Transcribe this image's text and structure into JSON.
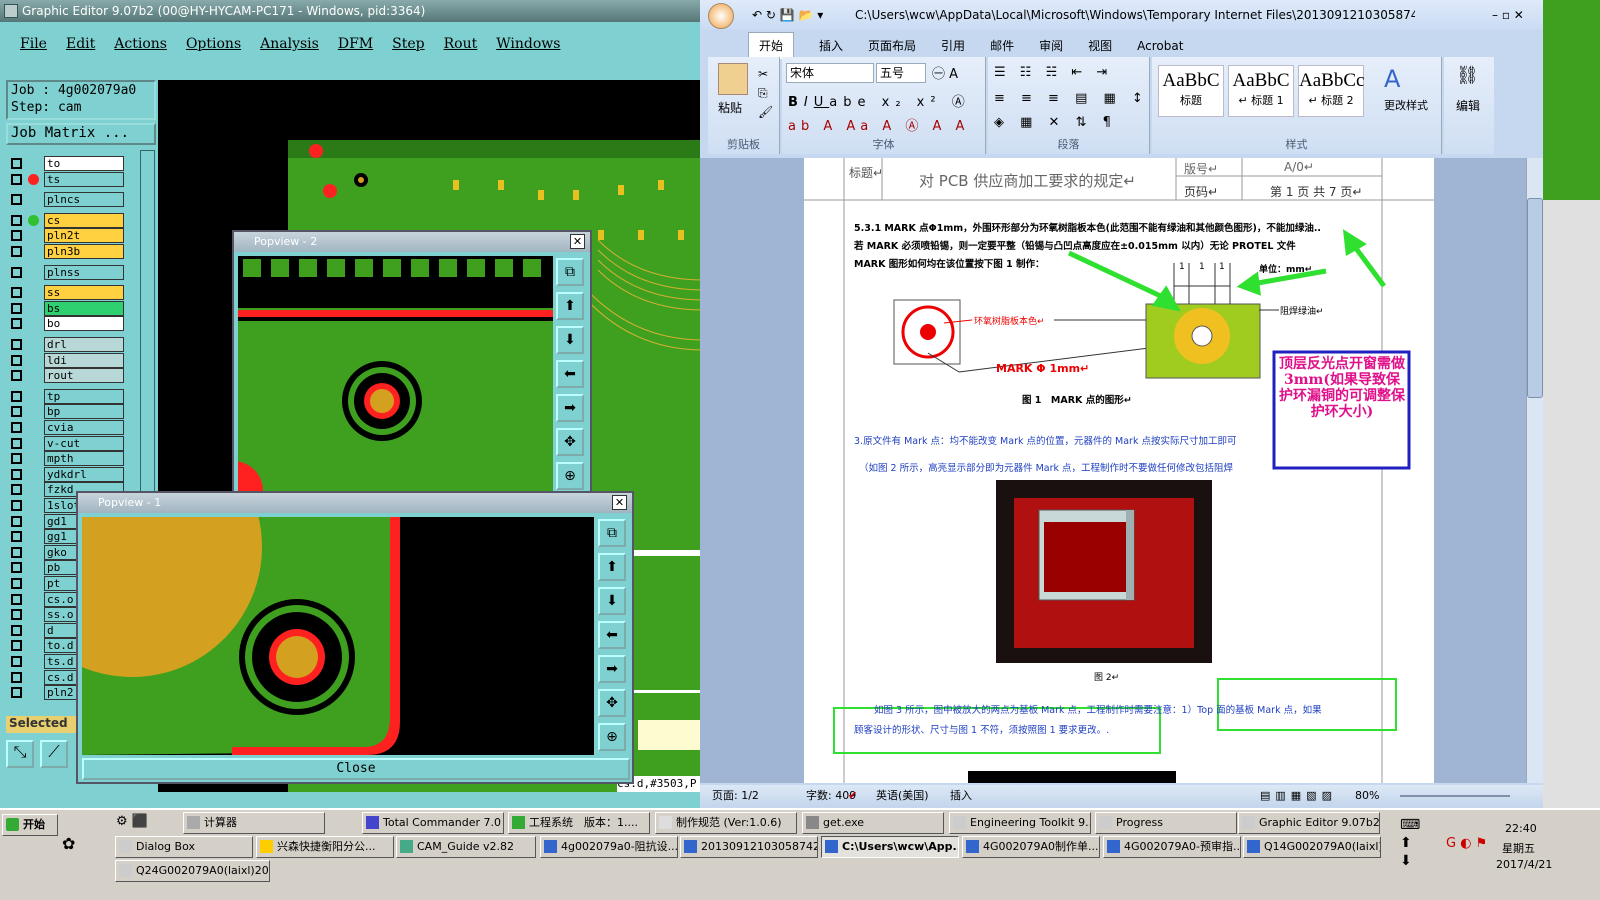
{
  "genesis": {
    "title": "Graphic Editor 9.07b2 (00@HY-HYCAM-PC171 - Windows, pid:3364)",
    "menu": [
      "File",
      "Edit",
      "Actions",
      "Options",
      "Analysis",
      "DFM",
      "Step",
      "Rout",
      "Windows"
    ],
    "job": "Job : 4g002079a0",
    "step": "Step: cam",
    "job_matrix": "Job Matrix ...",
    "layers": [
      "to",
      "ts",
      "plncs",
      "cs",
      "pln2t",
      "pln3b",
      "plnss",
      "ss",
      "bs",
      "bo",
      "drl",
      "ldi",
      "rout",
      "tp",
      "bp",
      "cvia",
      "v-cut",
      "mpth",
      "ydkdrl",
      "fzkd",
      "1slot",
      "gd1",
      "gg1",
      "gko",
      "pb",
      "pt",
      "cs.o",
      "ss.o",
      "d",
      "to.d",
      "ts.d",
      "cs.d",
      "pln2"
    ],
    "selected_label": "Selected",
    "coord_text": "cs.d,#3503,P",
    "popview2_title": "Popview - 2",
    "popview1_title": "Popview - 1",
    "close_label": "Close"
  },
  "word": {
    "title": "C:\\Users\\wcw\\AppData\\Local\\Microsoft\\Windows\\Temporary Internet Files\\20130912103058742.rtf 中... M",
    "tabs": [
      "开始",
      "插入",
      "页面布局",
      "引用",
      "邮件",
      "审阅",
      "视图",
      "Acrobat"
    ],
    "paste": "粘贴",
    "clipboard": "剪贴板",
    "font_name": "宋体",
    "font_size": "五号",
    "font_group": "字体",
    "para_group": "段落",
    "styles_group": "样式",
    "styles": [
      {
        "sample": "AaBbC",
        "name": "标题"
      },
      {
        "sample": "AaBbC",
        "name": "↵ 标题 1"
      },
      {
        "sample": "AaBbCc",
        "name": "↵ 标题 2"
      }
    ],
    "change_styles": "更改样式",
    "edit": "编辑",
    "header_label": "标题↵",
    "header_title": "对 PCB 供应商加工要求的规定↵",
    "version_label": "版号↵",
    "version_value": "A/0↵",
    "page_label": "页码↵",
    "page_value": "第 1 页 共 7 页↵",
    "para1": "5.3.1 MARK 点Φ1mm，外围环形部分为环氧树脂板本色(此范围不能有绿油和其他颜色图形)，不能加绿油..",
    "para1b": "若 MARK 必须喷铅锡，则一定要平整（铅锡与凸凹点高度应在±0.015mm 以内）无论 PROTEL 文件",
    "para1c": "MARK 图形如何均在该位置按下图 1 制作：",
    "dim_a": "1",
    "dim_b": "1",
    "dim_c": "1",
    "unit": "单位：mm↵",
    "solder_label": "阻焊绿油↵",
    "epoxy_label": "环氧树脂板本色↵",
    "mark_label": "MARK Φ 1mm↵",
    "fig1": "图 1　MARK 点的图形↵",
    "blue_note": "顶层反光点开窗需做3mm(如果导致保护环漏铜的可调整保护环大小)",
    "para2": "3.原文件有 Mark 点：均不能改变 Mark 点的位置，元器件的 Mark 点按实际尺寸加工即可",
    "para2b": "（如图 2 所示，高亮显示部分即为元器件 Mark 点，工程制作时不要做任何修改包括阻焊",
    "fig2": "图 2↵",
    "para3": "如图 3 所示，图中被放大的两点为基板 Mark 点，工程制作时需要注意：1）Top 面的基板 Mark 点，如果",
    "para3b": "顾客设计的形状、尺寸与图 1 不符，须按照图 1 要求更改。.",
    "status_page": "页面: 1/2",
    "status_words": "字数: 409",
    "status_lang": "英语(美国)",
    "status_insert": "插入",
    "zoom": "80%"
  },
  "taskbar": {
    "start": "开始",
    "row1": [
      "计算器",
      "Total Commander 7.0 ...",
      "工程系统　版本：1....",
      "制作规范 (Ver:1.0.6)",
      "get.exe",
      "Engineering Toolkit 9....",
      "Progress",
      "Graphic Editor 9.07b2 ..."
    ],
    "row2": [
      "Dialog Box",
      "兴森快捷衡阳分公...",
      "CAM_Guide v2.82",
      "4g002079a0-阻抗设...",
      "20130912103058742...",
      "C:\\Users\\wcw\\App...",
      "4G002079A0制作单...",
      "4G002079A0-预审指...",
      "Q14G002079A0(laixl)..."
    ],
    "row3": [
      "Q24G002079A0(laixl)201..."
    ],
    "time": "22:40",
    "weekday": "星期五",
    "date": "2017/4/21"
  },
  "colors": {
    "board_green": "#3fa020",
    "pad_gold": "#d4a020",
    "red": "#ff2020",
    "cyan_ui": "#7fd0d0"
  }
}
